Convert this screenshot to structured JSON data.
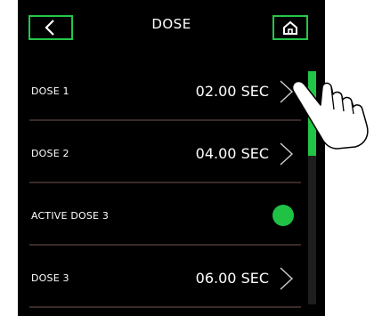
{
  "header": {
    "title": "DOSE",
    "back_icon": "chevron-left-icon",
    "home_icon": "home-icon"
  },
  "rows": [
    {
      "label": "DOSE 1",
      "value": "02.00 SEC",
      "control": "chevron-right-icon"
    },
    {
      "label": "DOSE 2",
      "value": "04.00 SEC",
      "control": "chevron-right-icon"
    },
    {
      "label": "ACTIVE DOSE 3",
      "value": "",
      "control": "toggle-on"
    },
    {
      "label": "DOSE 3",
      "value": "06.00 SEC",
      "control": "chevron-right-icon"
    }
  ],
  "scroll": {
    "position_fraction": 0.0,
    "visible_fraction": 0.36
  },
  "colors": {
    "accent": "#22c545",
    "background": "#000000",
    "divider": "#3a2b28",
    "text": "#ffffff"
  },
  "overlay_icon": "pointing-hand-icon"
}
